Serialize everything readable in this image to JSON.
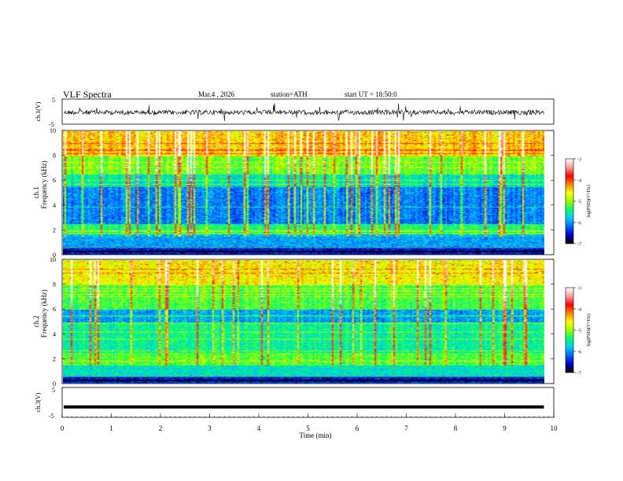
{
  "header": {
    "title": "VLF Spectra",
    "date": "Mar.4 , 2026",
    "station": "station=ATH",
    "start": "start UT = 18:50:0"
  },
  "chart_data": [
    {
      "type": "line",
      "ylabel": "ch.1(V)",
      "ylim": [
        -5,
        5
      ],
      "ytick_labels": [
        "5",
        "-5"
      ],
      "description_level": 0
    },
    {
      "type": "heatmap",
      "ylabel": "Frequency (kHz)",
      "channel_label": "ch.1",
      "ylim": [
        0,
        10
      ],
      "ytick_labels": [
        "0",
        "2",
        "4",
        "6",
        "8",
        "10"
      ],
      "colorbar": {
        "label": "log(PSD)(V²/Hz)",
        "range": [
          -7,
          -3
        ],
        "tick_labels": [
          "-3",
          "-4",
          "-5",
          "-6",
          "-7"
        ]
      }
    },
    {
      "type": "heatmap",
      "ylabel": "Frequency (kHz)",
      "channel_label": "ch.2",
      "ylim": [
        0,
        10
      ],
      "ytick_labels": [
        "0",
        "2",
        "4",
        "6",
        "8",
        "10"
      ],
      "colorbar": {
        "label": "log(PSD)(V²/Hz)",
        "range": [
          -7,
          -3
        ],
        "tick_labels": [
          "-3",
          "-4",
          "-5",
          "-6",
          "-7"
        ]
      }
    },
    {
      "type": "line",
      "ylabel": "ch.3(V)",
      "ylim": [
        -5,
        5
      ],
      "ytick_labels": [
        "5",
        "-5"
      ],
      "level": -1.5
    }
  ],
  "xaxis": {
    "label": "Time (min)",
    "range": [
      0,
      10
    ],
    "tick_labels": [
      "0",
      "1",
      "2",
      "3",
      "4",
      "5",
      "6",
      "7",
      "8",
      "9",
      "10"
    ],
    "data_end": 9.8
  },
  "colors": {
    "colormap": [
      "#000000",
      "#0000cc",
      "#0066ff",
      "#00ccff",
      "#00ff66",
      "#99ff00",
      "#ffff00",
      "#ff8800",
      "#ff0000",
      "#ff9999",
      "#ffffff"
    ]
  }
}
